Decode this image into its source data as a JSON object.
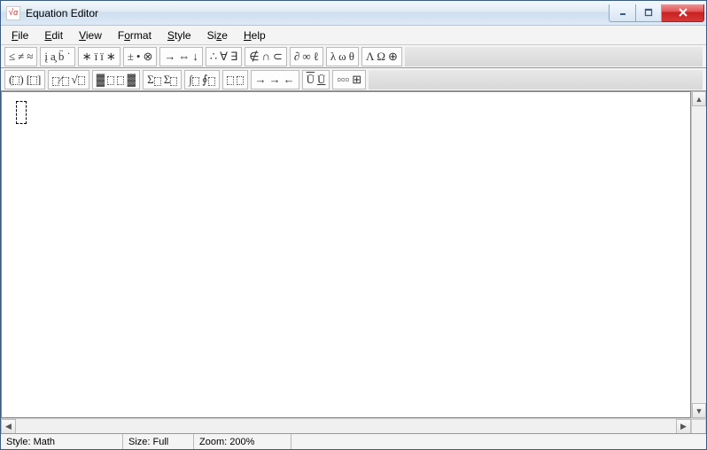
{
  "window": {
    "title": "Equation Editor"
  },
  "menu": {
    "file": "File",
    "edit": "Edit",
    "view": "View",
    "format": "Format",
    "style": "Style",
    "size": "Size",
    "help": "Help"
  },
  "toolbar_row1": {
    "g0": {
      "a": "≤",
      "b": "≠",
      "c": "≈"
    },
    "g1": {
      "a": "į",
      "b": "a̧",
      "c": "b̈",
      "d": "˙"
    },
    "g2": {
      "a": "∗",
      "b": "ï",
      "c": "ï",
      "d": "∗"
    },
    "g3": {
      "a": "±",
      "b": "•",
      "c": "⊗"
    },
    "g4": {
      "a": "→",
      "b": "⇔",
      "c": "↓"
    },
    "g5": {
      "a": "∴",
      "b": "∀",
      "c": "∃"
    },
    "g6": {
      "a": "∉",
      "b": "∩",
      "c": "⊂"
    },
    "g7": {
      "a": "∂",
      "b": "∞",
      "c": "ℓ"
    },
    "g8": {
      "a": "λ",
      "b": "ω",
      "c": "θ"
    },
    "g9": {
      "a": "Λ",
      "b": "Ω",
      "c": "⊕"
    }
  },
  "toolbar_row2": {
    "g0": {
      "a": "(▯)",
      "b": "[▯]"
    },
    "g1": {
      "a": "▯⁄▯",
      "b": "√▯"
    },
    "g2": {
      "a": "▯:",
      "b": "▯"
    },
    "g3": {
      "a": "Σ▯",
      "b": "Σ▯"
    },
    "g4": {
      "a": "∫▯",
      "b": "∮▯"
    },
    "g5": {
      "a": "▯̄",
      "b": "▯"
    },
    "g6": {
      "a": "→",
      "b": "→",
      "c": "←"
    },
    "g7": {
      "a": "Ų̄",
      "b": "Ų̄"
    },
    "g8": {
      "a": "▯▯▯",
      "b": "⊞"
    }
  },
  "status": {
    "style_label": "Style: Math",
    "size_label": "Size: Full",
    "zoom_label": "Zoom: 200%"
  }
}
